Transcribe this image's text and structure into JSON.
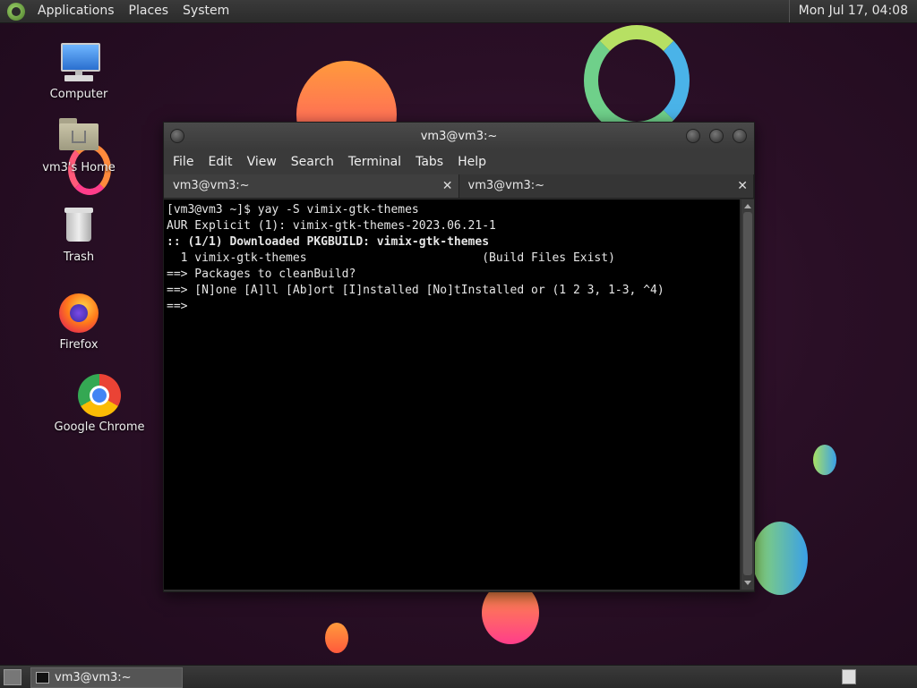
{
  "top_panel": {
    "menus": [
      "Applications",
      "Places",
      "System"
    ],
    "clock": "Mon Jul 17, 04:08"
  },
  "desktop": {
    "icons": [
      {
        "label": "Computer",
        "icon": "computer-icon"
      },
      {
        "label": "vm3's Home",
        "icon": "home-folder-icon"
      },
      {
        "label": "Trash",
        "icon": "trash-icon"
      },
      {
        "label": "Firefox",
        "icon": "firefox-icon"
      },
      {
        "label": "Google Chrome",
        "icon": "chrome-icon"
      }
    ]
  },
  "window": {
    "title": "vm3@vm3:~",
    "menus": [
      "File",
      "Edit",
      "View",
      "Search",
      "Terminal",
      "Tabs",
      "Help"
    ],
    "tabs": [
      {
        "label": "vm3@vm3:~",
        "active": true
      },
      {
        "label": "vm3@vm3:~",
        "active": false
      }
    ],
    "tab_close": "✕",
    "terminal_lines": [
      "[vm3@vm3 ~]$ yay -S vimix-gtk-themes",
      "AUR Explicit (1): vimix-gtk-themes-2023.06.21-1",
      ":: (1/1) Downloaded PKGBUILD: vimix-gtk-themes",
      "  1 vimix-gtk-themes                         (Build Files Exist)",
      "==> Packages to cleanBuild?",
      "==> [N]one [A]ll [Ab]ort [I]nstalled [No]tInstalled or (1 2 3, 1-3, ^4)",
      "==>"
    ]
  },
  "taskbar": {
    "task_label": "vm3@vm3:~"
  },
  "colors": {
    "background": "#2a0f26",
    "terminal_bg": "#000000",
    "terminal_fg": "#e6e6e6"
  }
}
